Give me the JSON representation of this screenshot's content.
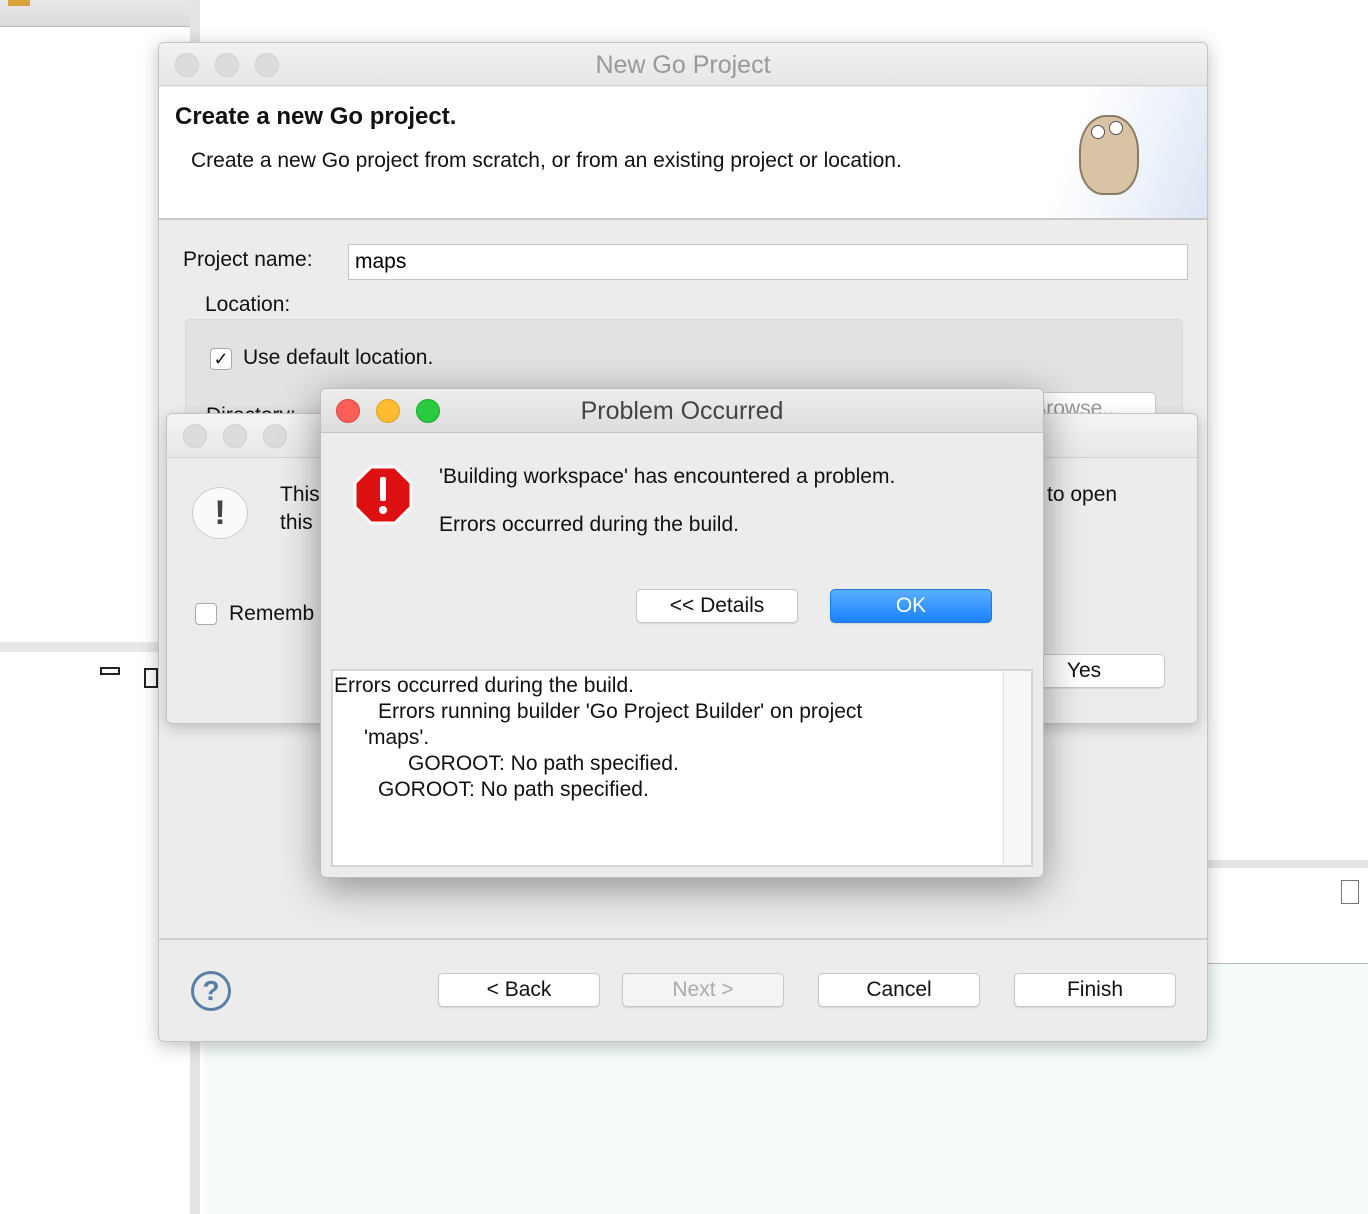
{
  "main_dialog": {
    "title": "New Go Project",
    "heading": "Create a new Go project.",
    "description": "Create a new Go project from scratch, or from an existing project or location.",
    "project_name_label": "Project name:",
    "project_name_value": "maps",
    "location_label": "Location:",
    "use_default_label": "Use default location.",
    "use_default_checked": true,
    "directory_label": "Directory:",
    "browse_label": "Browse...",
    "buttons": {
      "back": "< Back",
      "next": "Next >",
      "cancel": "Cancel",
      "finish": "Finish"
    }
  },
  "confirm_dialog": {
    "text_line1_start": "This",
    "text_line1_end": "to open",
    "text_line2_start": "this",
    "remember_label": "Rememb",
    "yes_label": "Yes"
  },
  "problem_dialog": {
    "title": "Problem Occurred",
    "message": "'Building workspace' has encountered a problem.",
    "detail_message": "Errors occurred during the build.",
    "details_button": "<< Details",
    "ok_button": "OK",
    "details_lines": [
      "Errors occurred during the build.",
      "Errors running builder 'Go Project Builder' on project",
      "'maps'.",
      "GOROOT: No path specified.",
      "GOROOT: No path specified."
    ],
    "accent": "#1a82fb"
  }
}
